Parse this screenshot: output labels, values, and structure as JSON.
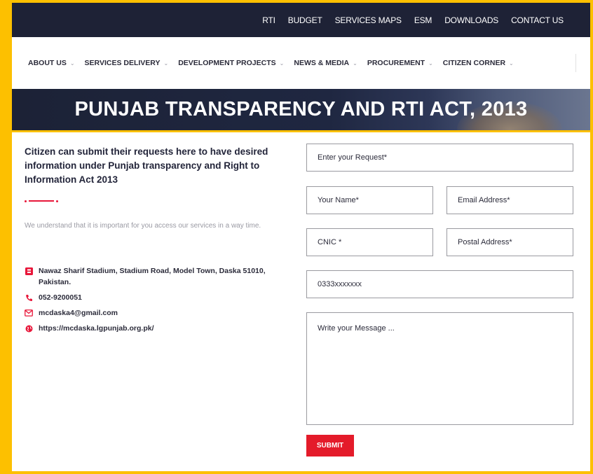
{
  "topbar": {
    "links": [
      "RTI",
      "BUDGET",
      "SERVICES MAPS",
      "ESM",
      "DOWNLOADS",
      "CONTACT US"
    ]
  },
  "nav": {
    "items": [
      {
        "label": "ABOUT US"
      },
      {
        "label": "SERVICES DELIVERY"
      },
      {
        "label": "DEVELOPMENT PROJECTS"
      },
      {
        "label": "NEWS & MEDIA"
      },
      {
        "label": "PROCUREMENT"
      },
      {
        "label": "CITIZEN CORNER"
      }
    ]
  },
  "banner": {
    "title": "PUNJAB TRANSPARENCY AND RTI ACT, 2013"
  },
  "intro": {
    "heading": "Citizen can submit their requests here to have desired information under Punjab transparency and Right to Information Act 2013",
    "description": "We understand that it is important for you access our services in a way time."
  },
  "contact": {
    "address": "Nawaz Sharif Stadium, Stadium Road, Model Town, Daska 51010, Pakistan.",
    "phone": "052-9200051",
    "email": "mcdaska4@gmail.com",
    "website": "https://mcdaska.lgpunjab.org.pk/"
  },
  "form": {
    "request": "Enter your Request*",
    "name": "Your Name*",
    "email": "Email Address*",
    "cnic": "CNIC *",
    "postal": "Postal Address*",
    "phone": "0333xxxxxxx",
    "message": "Write your Message ...",
    "submit_label": "SUBMIT"
  },
  "colors": {
    "frame": "#fdc000",
    "topbar_bg": "#1e2236",
    "accent_red": "#e41b2a"
  }
}
